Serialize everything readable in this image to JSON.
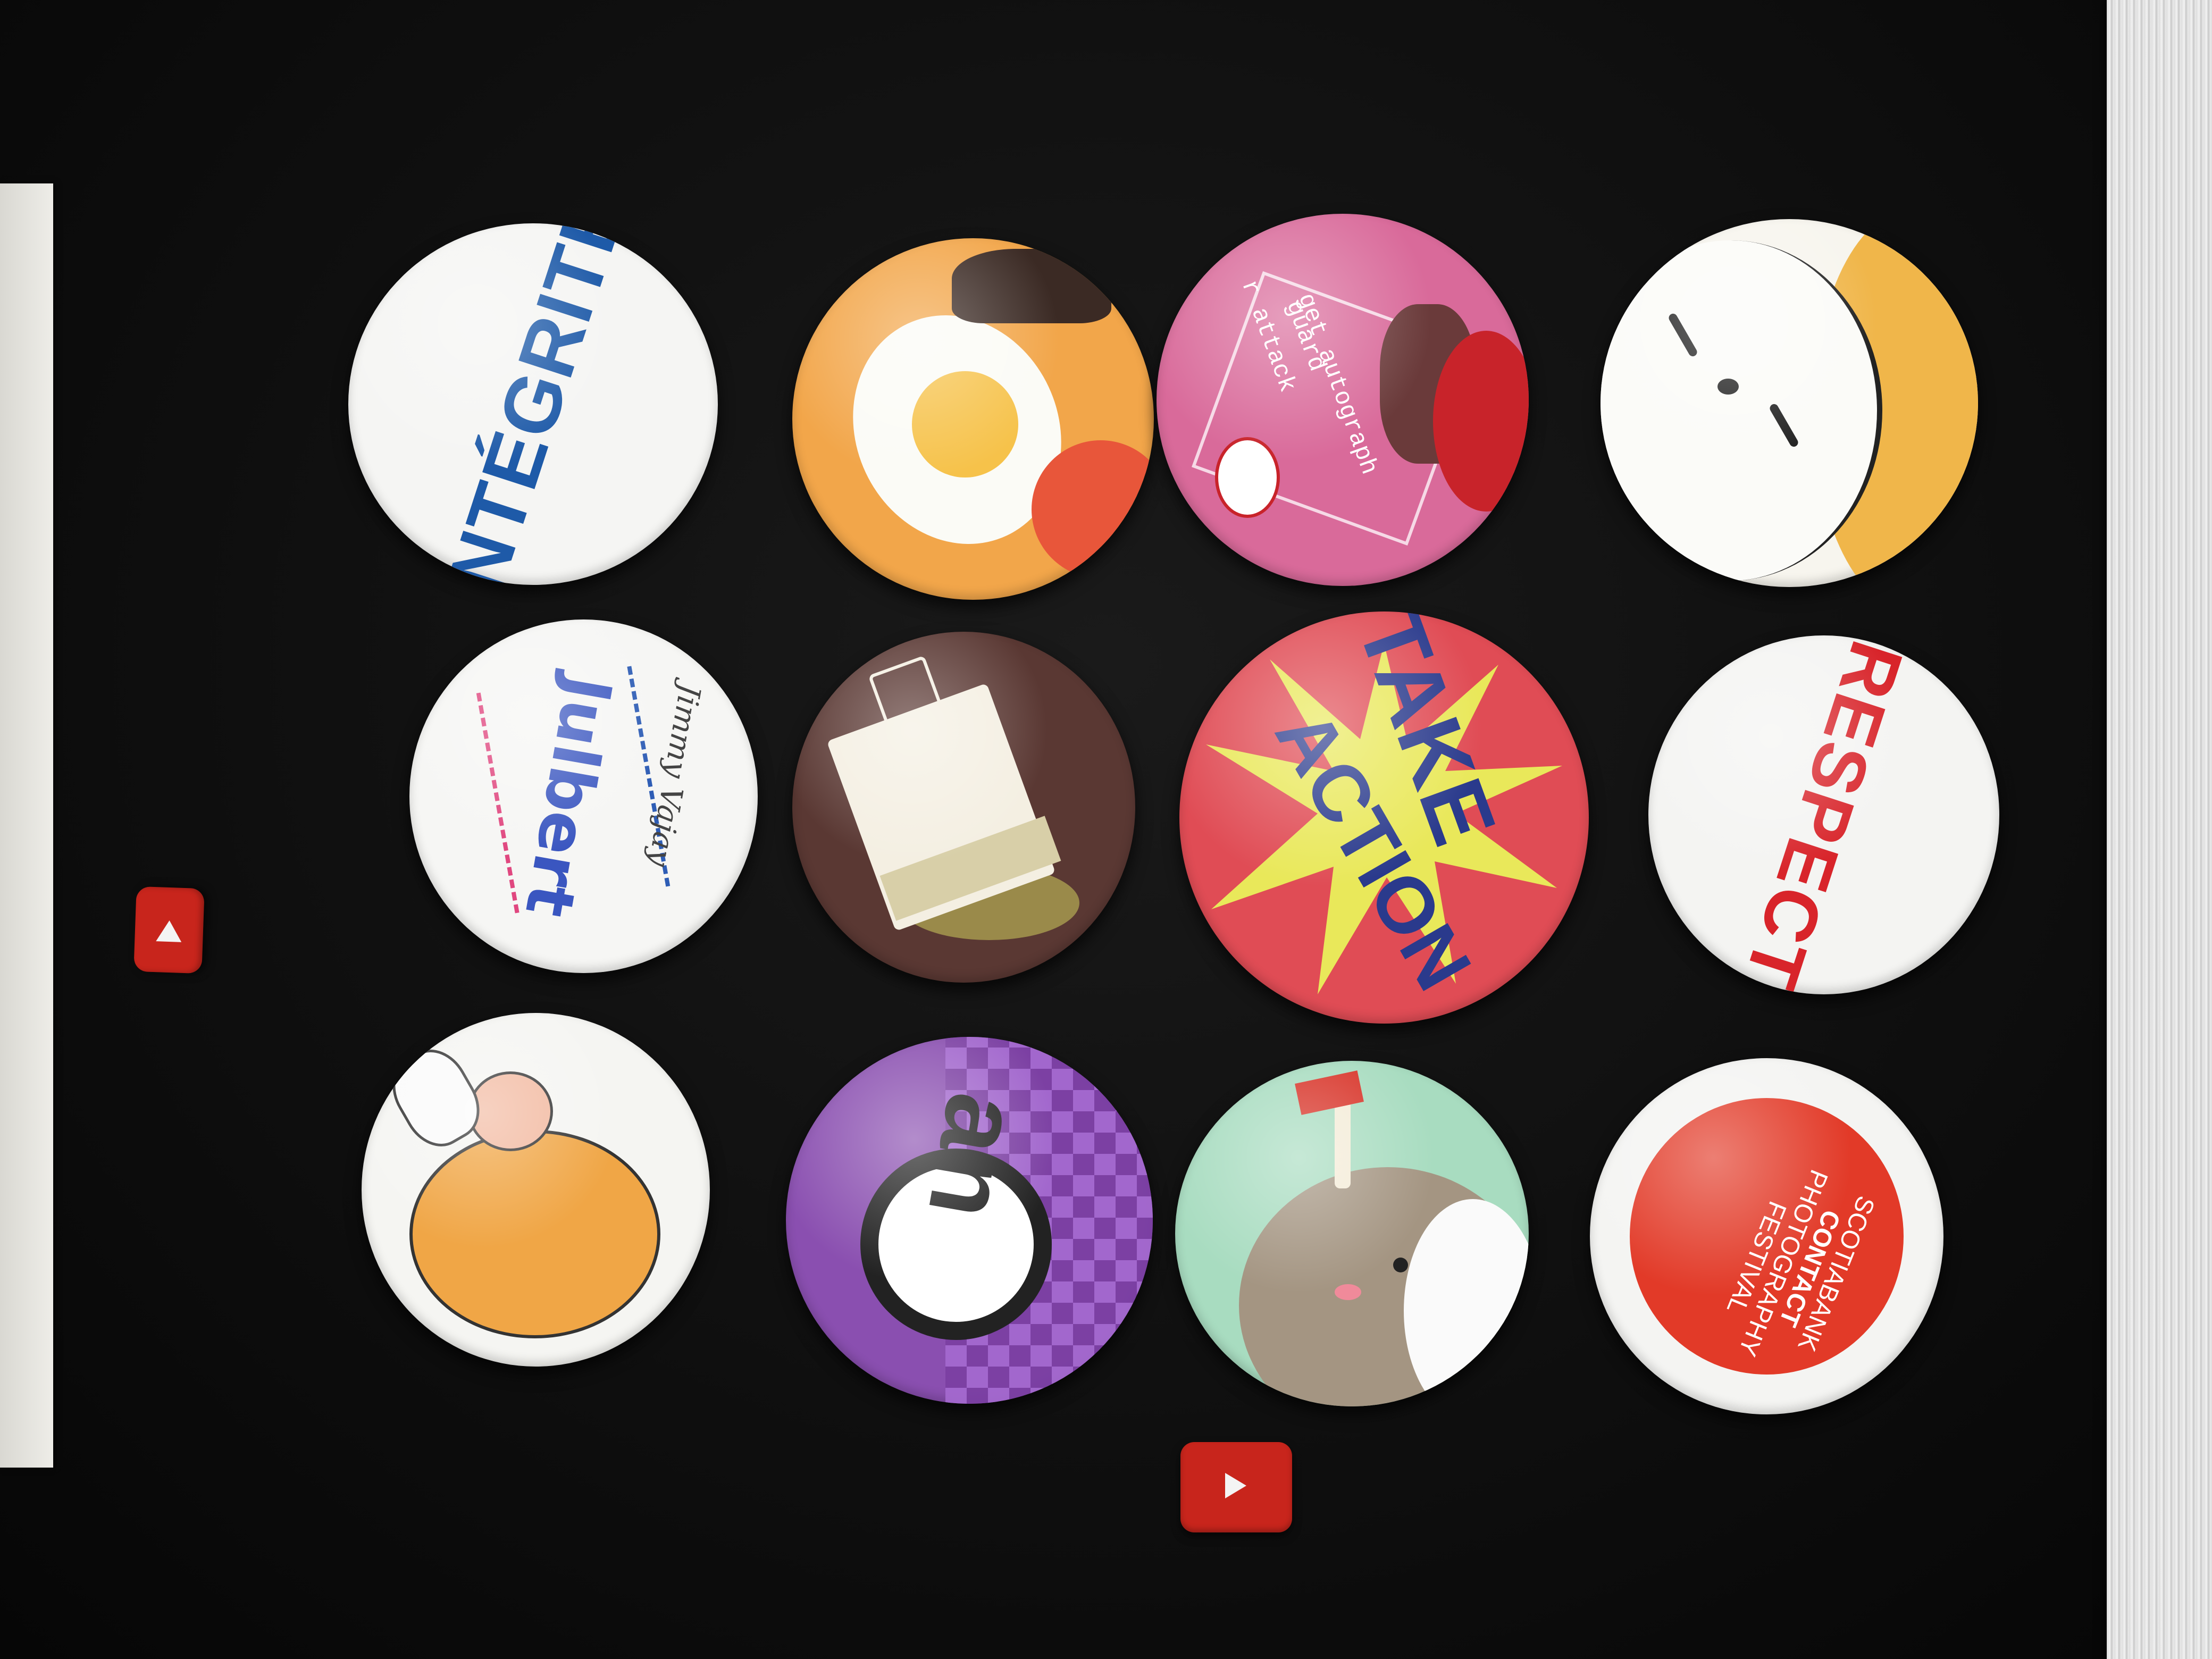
{
  "badges": {
    "integrite": {
      "text": "INTÉGRITÉ",
      "bg": "#f5f5f3",
      "color": "#1e5aa8"
    },
    "egg": {
      "bg": "#f2a64a"
    },
    "autograph": {
      "line1": "r attack",
      "line2": "guard",
      "line3": "get autograph",
      "bg": "#d96a9a"
    },
    "cat": {
      "bg": "#f7f5ee",
      "accent": "#f0b64a"
    },
    "julbert": {
      "main": "Julbert",
      "sub": "Jimmy Vajay",
      "bg": "#f6f6f4"
    },
    "teabag": {
      "bg": "#5a3833"
    },
    "take_action": {
      "line1": "TAKE",
      "line2": "ACTION",
      "bg": "#e04c55",
      "burst": "#e9e85a",
      "color": "#2a3a8c"
    },
    "respect": {
      "text": "RESPECT",
      "bg": "#f4f4f2",
      "color": "#d8242a"
    },
    "sleeper": {
      "bg": "#f5f5f2",
      "accent": "#f0a646"
    },
    "an_logo": {
      "text": "an",
      "bg": "#8a4fb0"
    },
    "narwhal": {
      "bg": "#a8dcc0"
    },
    "contact": {
      "line1": "SCOTIABANK",
      "line2": "CONTACT",
      "line3": "PHOTOGRAPHY",
      "line4": "FESTIVAL",
      "bg": "#e23a28"
    }
  },
  "colors": {
    "table": "#111111",
    "youtube_red": "#c8251c"
  },
  "icons": [
    "play-icon",
    "play-icon"
  ]
}
